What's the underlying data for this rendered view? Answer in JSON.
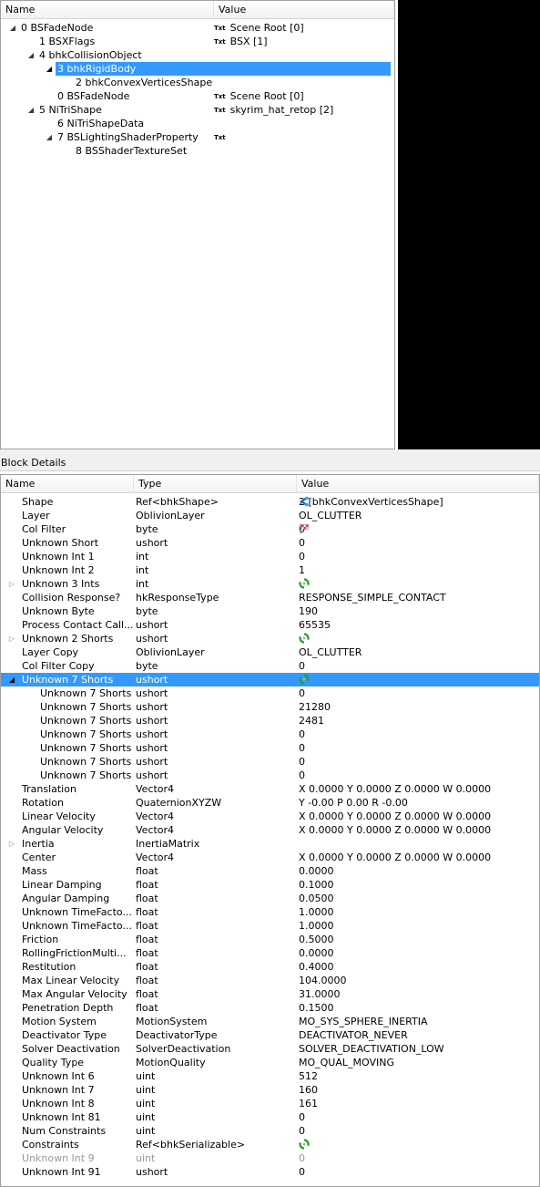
{
  "tree": {
    "col_name": "Name",
    "col_value": "Value",
    "rows": [
      {
        "label": "0 BSFadeNode",
        "value": "Scene Root [0]",
        "txt": true,
        "depth": 0,
        "expander": "open",
        "selected": false
      },
      {
        "label": "1 BSXFlags",
        "value": "BSX [1]",
        "txt": true,
        "depth": 1,
        "expander": "none",
        "selected": false
      },
      {
        "label": "4 bhkCollisionObject",
        "value": "",
        "txt": false,
        "depth": 1,
        "expander": "open",
        "selected": false
      },
      {
        "label": "3 bhkRigidBody",
        "value": "",
        "txt": false,
        "depth": 2,
        "expander": "open",
        "selected": true
      },
      {
        "label": "2 bhkConvexVerticesShape",
        "value": "",
        "txt": false,
        "depth": 3,
        "expander": "none",
        "selected": false
      },
      {
        "label": "0 BSFadeNode",
        "value": "Scene Root [0]",
        "txt": true,
        "depth": 2,
        "expander": "none",
        "selected": false
      },
      {
        "label": "5 NiTriShape",
        "value": "skyrim_hat_retop [2]",
        "txt": true,
        "depth": 1,
        "expander": "open",
        "selected": false
      },
      {
        "label": "6 NiTriShapeData",
        "value": "",
        "txt": false,
        "depth": 2,
        "expander": "none",
        "selected": false
      },
      {
        "label": "7 BSLightingShaderProperty",
        "value": "",
        "txt": true,
        "depth": 2,
        "expander": "open",
        "selected": false
      },
      {
        "label": "8 BSShaderTextureSet",
        "value": "",
        "txt": false,
        "depth": 3,
        "expander": "none",
        "selected": false
      }
    ],
    "txt_badge": "Txt"
  },
  "block_details": {
    "title": "Block Details",
    "col_name": "Name",
    "col_type": "Type",
    "col_value": "Value",
    "rows": [
      {
        "name": "Shape",
        "type": "Ref<bhkShape>",
        "value": "2 [bhkConvexVerticesShape]",
        "icon": "link-icon",
        "depth": 0,
        "expander": "none",
        "selected": false,
        "disabled": false
      },
      {
        "name": "Layer",
        "type": "OblivionLayer",
        "value": "OL_CLUTTER",
        "icon": "",
        "depth": 0,
        "expander": "none",
        "selected": false,
        "disabled": false
      },
      {
        "name": "Col Filter",
        "type": "byte",
        "value": "0",
        "icon": "flag-icon",
        "depth": 0,
        "expander": "none",
        "selected": false,
        "disabled": false
      },
      {
        "name": "Unknown Short",
        "type": "ushort",
        "value": "0",
        "icon": "",
        "depth": 0,
        "expander": "none",
        "selected": false,
        "disabled": false
      },
      {
        "name": "Unknown Int 1",
        "type": "int",
        "value": "0",
        "icon": "",
        "depth": 0,
        "expander": "none",
        "selected": false,
        "disabled": false
      },
      {
        "name": "Unknown Int 2",
        "type": "int",
        "value": "1",
        "icon": "",
        "depth": 0,
        "expander": "none",
        "selected": false,
        "disabled": false
      },
      {
        "name": "Unknown 3 Ints",
        "type": "int",
        "value": "",
        "icon": "array-icon",
        "depth": 0,
        "expander": "closed",
        "selected": false,
        "disabled": false
      },
      {
        "name": "Collision Response?",
        "type": "hkResponseType",
        "value": "RESPONSE_SIMPLE_CONTACT",
        "icon": "",
        "depth": 0,
        "expander": "none",
        "selected": false,
        "disabled": false
      },
      {
        "name": "Unknown Byte",
        "type": "byte",
        "value": "190",
        "icon": "",
        "depth": 0,
        "expander": "none",
        "selected": false,
        "disabled": false
      },
      {
        "name": "Process Contact Call...",
        "type": "ushort",
        "value": "65535",
        "icon": "",
        "depth": 0,
        "expander": "none",
        "selected": false,
        "disabled": false
      },
      {
        "name": "Unknown 2 Shorts",
        "type": "ushort",
        "value": "",
        "icon": "array-icon",
        "depth": 0,
        "expander": "closed",
        "selected": false,
        "disabled": false
      },
      {
        "name": "Layer Copy",
        "type": "OblivionLayer",
        "value": "OL_CLUTTER",
        "icon": "",
        "depth": 0,
        "expander": "none",
        "selected": false,
        "disabled": false
      },
      {
        "name": "Col Filter Copy",
        "type": "byte",
        "value": "0",
        "icon": "",
        "depth": 0,
        "expander": "none",
        "selected": false,
        "disabled": false
      },
      {
        "name": "Unknown 7 Shorts",
        "type": "ushort",
        "value": "",
        "icon": "array-icon",
        "depth": 0,
        "expander": "open",
        "selected": true,
        "disabled": false
      },
      {
        "name": "Unknown 7 Shorts",
        "type": "ushort",
        "value": "0",
        "icon": "",
        "depth": 1,
        "expander": "none",
        "selected": false,
        "disabled": false
      },
      {
        "name": "Unknown 7 Shorts",
        "type": "ushort",
        "value": "21280",
        "icon": "",
        "depth": 1,
        "expander": "none",
        "selected": false,
        "disabled": false
      },
      {
        "name": "Unknown 7 Shorts",
        "type": "ushort",
        "value": "2481",
        "icon": "",
        "depth": 1,
        "expander": "none",
        "selected": false,
        "disabled": false
      },
      {
        "name": "Unknown 7 Shorts",
        "type": "ushort",
        "value": "0",
        "icon": "",
        "depth": 1,
        "expander": "none",
        "selected": false,
        "disabled": false
      },
      {
        "name": "Unknown 7 Shorts",
        "type": "ushort",
        "value": "0",
        "icon": "",
        "depth": 1,
        "expander": "none",
        "selected": false,
        "disabled": false
      },
      {
        "name": "Unknown 7 Shorts",
        "type": "ushort",
        "value": "0",
        "icon": "",
        "depth": 1,
        "expander": "none",
        "selected": false,
        "disabled": false
      },
      {
        "name": "Unknown 7 Shorts",
        "type": "ushort",
        "value": "0",
        "icon": "",
        "depth": 1,
        "expander": "none",
        "selected": false,
        "disabled": false
      },
      {
        "name": "Translation",
        "type": "Vector4",
        "value": "X 0.0000 Y 0.0000 Z 0.0000 W 0.0000",
        "icon": "",
        "depth": 0,
        "expander": "none",
        "selected": false,
        "disabled": false
      },
      {
        "name": "Rotation",
        "type": "QuaternionXYZW",
        "value": "Y -0.00 P 0.00 R -0.00",
        "icon": "",
        "depth": 0,
        "expander": "none",
        "selected": false,
        "disabled": false
      },
      {
        "name": "Linear Velocity",
        "type": "Vector4",
        "value": "X 0.0000 Y 0.0000 Z 0.0000 W 0.0000",
        "icon": "",
        "depth": 0,
        "expander": "none",
        "selected": false,
        "disabled": false
      },
      {
        "name": "Angular Velocity",
        "type": "Vector4",
        "value": "X 0.0000 Y 0.0000 Z 0.0000 W 0.0000",
        "icon": "",
        "depth": 0,
        "expander": "none",
        "selected": false,
        "disabled": false
      },
      {
        "name": "Inertia",
        "type": "InertiaMatrix",
        "value": "",
        "icon": "",
        "depth": 0,
        "expander": "closed",
        "selected": false,
        "disabled": false
      },
      {
        "name": "Center",
        "type": "Vector4",
        "value": "X 0.0000 Y 0.0000 Z 0.0000 W 0.0000",
        "icon": "",
        "depth": 0,
        "expander": "none",
        "selected": false,
        "disabled": false
      },
      {
        "name": "Mass",
        "type": "float",
        "value": "0.0000",
        "icon": "",
        "depth": 0,
        "expander": "none",
        "selected": false,
        "disabled": false
      },
      {
        "name": "Linear Damping",
        "type": "float",
        "value": "0.1000",
        "icon": "",
        "depth": 0,
        "expander": "none",
        "selected": false,
        "disabled": false
      },
      {
        "name": "Angular Damping",
        "type": "float",
        "value": "0.0500",
        "icon": "",
        "depth": 0,
        "expander": "none",
        "selected": false,
        "disabled": false
      },
      {
        "name": "Unknown TimeFacto...",
        "type": "float",
        "value": "1.0000",
        "icon": "",
        "depth": 0,
        "expander": "none",
        "selected": false,
        "disabled": false
      },
      {
        "name": "Unknown TimeFacto...",
        "type": "float",
        "value": "1.0000",
        "icon": "",
        "depth": 0,
        "expander": "none",
        "selected": false,
        "disabled": false
      },
      {
        "name": "Friction",
        "type": "float",
        "value": "0.5000",
        "icon": "",
        "depth": 0,
        "expander": "none",
        "selected": false,
        "disabled": false
      },
      {
        "name": "RollingFrictionMulti...",
        "type": "float",
        "value": "0.0000",
        "icon": "",
        "depth": 0,
        "expander": "none",
        "selected": false,
        "disabled": false
      },
      {
        "name": "Restitution",
        "type": "float",
        "value": "0.4000",
        "icon": "",
        "depth": 0,
        "expander": "none",
        "selected": false,
        "disabled": false
      },
      {
        "name": "Max Linear Velocity",
        "type": "float",
        "value": "104.0000",
        "icon": "",
        "depth": 0,
        "expander": "none",
        "selected": false,
        "disabled": false
      },
      {
        "name": "Max Angular Velocity",
        "type": "float",
        "value": "31.0000",
        "icon": "",
        "depth": 0,
        "expander": "none",
        "selected": false,
        "disabled": false
      },
      {
        "name": "Penetration Depth",
        "type": "float",
        "value": "0.1500",
        "icon": "",
        "depth": 0,
        "expander": "none",
        "selected": false,
        "disabled": false
      },
      {
        "name": "Motion System",
        "type": "MotionSystem",
        "value": "MO_SYS_SPHERE_INERTIA",
        "icon": "",
        "depth": 0,
        "expander": "none",
        "selected": false,
        "disabled": false
      },
      {
        "name": "Deactivator Type",
        "type": "DeactivatorType",
        "value": "DEACTIVATOR_NEVER",
        "icon": "",
        "depth": 0,
        "expander": "none",
        "selected": false,
        "disabled": false
      },
      {
        "name": "Solver Deactivation",
        "type": "SolverDeactivation",
        "value": "SOLVER_DEACTIVATION_LOW",
        "icon": "",
        "depth": 0,
        "expander": "none",
        "selected": false,
        "disabled": false
      },
      {
        "name": "Quality Type",
        "type": "MotionQuality",
        "value": "MO_QUAL_MOVING",
        "icon": "",
        "depth": 0,
        "expander": "none",
        "selected": false,
        "disabled": false
      },
      {
        "name": "Unknown Int 6",
        "type": "uint",
        "value": "512",
        "icon": "",
        "depth": 0,
        "expander": "none",
        "selected": false,
        "disabled": false
      },
      {
        "name": "Unknown Int 7",
        "type": "uint",
        "value": "160",
        "icon": "",
        "depth": 0,
        "expander": "none",
        "selected": false,
        "disabled": false
      },
      {
        "name": "Unknown Int 8",
        "type": "uint",
        "value": "161",
        "icon": "",
        "depth": 0,
        "expander": "none",
        "selected": false,
        "disabled": false
      },
      {
        "name": "Unknown Int 81",
        "type": "uint",
        "value": "0",
        "icon": "",
        "depth": 0,
        "expander": "none",
        "selected": false,
        "disabled": false
      },
      {
        "name": "Num Constraints",
        "type": "uint",
        "value": "0",
        "icon": "",
        "depth": 0,
        "expander": "none",
        "selected": false,
        "disabled": false
      },
      {
        "name": "Constraints",
        "type": "Ref<bhkSerializable>",
        "value": "",
        "icon": "array-icon",
        "depth": 0,
        "expander": "none",
        "selected": false,
        "disabled": false
      },
      {
        "name": "Unknown Int 9",
        "type": "uint",
        "value": "0",
        "icon": "",
        "depth": 0,
        "expander": "none",
        "selected": false,
        "disabled": true
      },
      {
        "name": "Unknown Int 91",
        "type": "ushort",
        "value": "0",
        "icon": "",
        "depth": 0,
        "expander": "none",
        "selected": false,
        "disabled": false
      }
    ]
  },
  "colors": {
    "selection": "#3399ff",
    "disabled_text": "#999999"
  }
}
